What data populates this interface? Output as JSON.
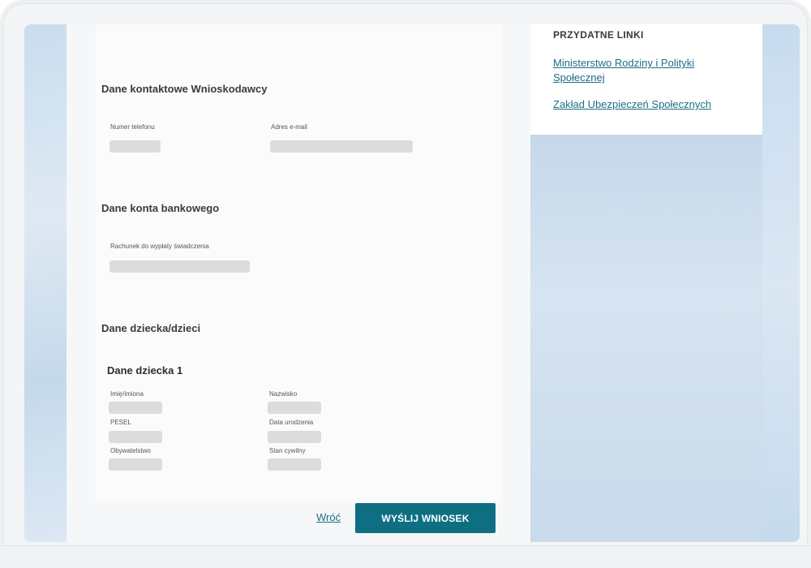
{
  "form": {
    "contact_section": {
      "title": "Dane kontaktowe Wnioskodawcy",
      "phone_label": "Numer telefonu",
      "email_label": "Adres e-mail"
    },
    "bank_section": {
      "title": "Dane konta bankowego",
      "account_label": "Rachunek do wypłaty świadczenia"
    },
    "children_section": {
      "title": "Dane dziecka/dzieci",
      "child_title": "Dane dziecka 1",
      "first_name_label": "Imię/imiona",
      "last_name_label": "Nazwisko",
      "pesel_label": "PESEL",
      "birth_date_label": "Data urodzenia",
      "citizenship_label": "Obywatelstwo",
      "marital_status_label": "Stan cywilny"
    },
    "actions": {
      "back_label": "Wróć",
      "submit_label": "WYŚLIJ WNIOSEK"
    }
  },
  "sidebar": {
    "title": "PRZYDATNE LINKI",
    "links": [
      {
        "label": "Ministerstwo Rodziny i Polityki Społecznej"
      },
      {
        "label": "Zakład Ubezpieczeń Społecznych"
      }
    ]
  },
  "colors": {
    "accent": "#0e6f82",
    "link": "#1e6e86",
    "placeholder_fill": "#dcdcdc"
  }
}
